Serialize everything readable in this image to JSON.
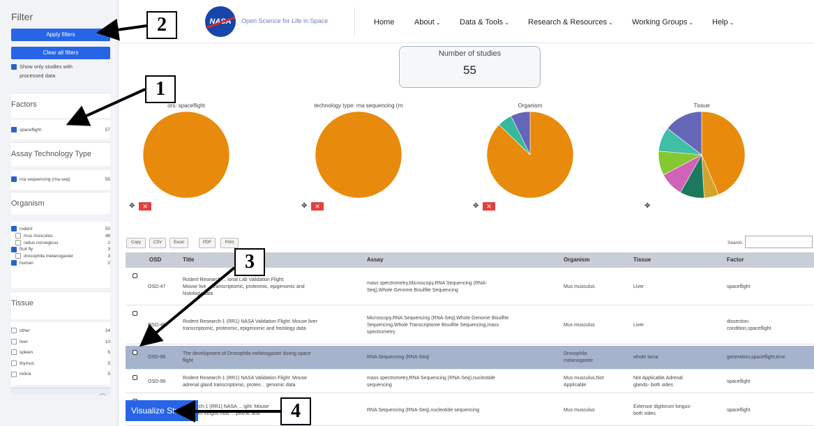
{
  "sidebar": {
    "title": "Filter",
    "apply_label": "Apply filters",
    "clear_label": "Clear all filters",
    "processed_label_1": "Show only studies with",
    "processed_label_2": "processed data",
    "factors": {
      "heading": "Factors",
      "items": [
        {
          "label": "spaceflight",
          "count": "57",
          "checked": true
        }
      ]
    },
    "assay": {
      "heading": "Assay Technology Type",
      "items": [
        {
          "label": "rna sequencing (rna-seq)",
          "count": "55",
          "checked": true
        }
      ]
    },
    "organism": {
      "heading": "Organism",
      "items": [
        {
          "label": "rodent",
          "count": "50",
          "checked": true,
          "sub": false
        },
        {
          "label": "mus musculus",
          "count": "48",
          "checked": false,
          "sub": true
        },
        {
          "label": "rattus norvegicus",
          "count": "2",
          "checked": false,
          "sub": true
        },
        {
          "label": "fruit fly",
          "count": "3",
          "checked": true,
          "sub": false
        },
        {
          "label": "drosophila melanogaster",
          "count": "3",
          "checked": false,
          "sub": true
        },
        {
          "label": "human",
          "count": "2",
          "checked": true,
          "sub": false
        }
      ]
    },
    "tissue": {
      "heading": "Tissue",
      "items": [
        {
          "label": "other",
          "count": "24"
        },
        {
          "label": "liver",
          "count": "10"
        },
        {
          "label": "spleen",
          "count": "5"
        },
        {
          "label": "thymus",
          "count": "5"
        },
        {
          "label": "retina",
          "count": "5"
        }
      ]
    }
  },
  "header": {
    "logo_text": "NASA",
    "site_title": "Open Science for Life in Space",
    "nav": [
      {
        "label": "Home",
        "dropdown": false
      },
      {
        "label": "About",
        "dropdown": true
      },
      {
        "label": "Data & Tools",
        "dropdown": true
      },
      {
        "label": "Research & Resources",
        "dropdown": true
      },
      {
        "label": "Working Groups",
        "dropdown": true
      },
      {
        "label": "Help",
        "dropdown": true
      }
    ]
  },
  "studies": {
    "label": "Number of studies",
    "value": "55"
  },
  "charts": [
    {
      "title": "ors: spaceflight",
      "slices": [
        {
          "value": 1,
          "color": "#e88a0c"
        }
      ],
      "has_remove": true
    },
    {
      "title": "technology type: rna sequencing (rn",
      "slices": [
        {
          "value": 1,
          "color": "#e88a0c"
        }
      ],
      "has_remove": true
    },
    {
      "title": "Organism",
      "slices": [
        {
          "value": 48,
          "color": "#e88a0c"
        },
        {
          "value": 3,
          "color": "#35b89c"
        },
        {
          "value": 4,
          "color": "#6666b8"
        }
      ],
      "has_remove": true
    },
    {
      "title": "Tissue",
      "slices": [
        {
          "value": 24,
          "color": "#e88a0c"
        },
        {
          "value": 3,
          "color": "#d4a52c"
        },
        {
          "value": 5,
          "color": "#1c7a5c"
        },
        {
          "value": 5,
          "color": "#d062b8"
        },
        {
          "value": 5,
          "color": "#86c832"
        },
        {
          "value": 5,
          "color": "#3fbfa8"
        },
        {
          "value": 8,
          "color": "#6666b8"
        }
      ],
      "has_remove": false
    }
  ],
  "table_tools": {
    "copy": "Copy",
    "csv": "CSV",
    "excel": "Excel",
    "pdf": "PDF",
    "print": "Print",
    "search_label": "Search:"
  },
  "table": {
    "headers": {
      "osd": "OSD",
      "title": "Title",
      "assay": "Assay",
      "organism": "Organism",
      "tissue": "Tissue",
      "factor": "Factor"
    },
    "rows": [
      {
        "osd": "OSD-47",
        "title": [
          "Rodent Research ... ional Lab Validation Flight:",
          "Mouse live ... transcriptomic, proteomic, epigenomic and",
          "histology data"
        ],
        "assay": [
          "mass spectrometry,Microscopy,RNA Sequencing (RNA-",
          "Seq),Whole Genome Bisulfite Sequencing"
        ],
        "organism": [
          "Mus musculus"
        ],
        "tissue": [
          "Liver"
        ],
        "factor": [
          "spaceflight"
        ],
        "selected": false
      },
      {
        "osd": "OSD-48",
        "title": [
          "Rodent Research-1 (RR1) NASA Validation Flight: Mouse liver",
          "transcriptomic, proteomic, epigenomic and histology data"
        ],
        "assay": [
          "Microscopy,RNA Sequencing (RNA-Seq),Whole Genome Bisulfite",
          "Sequencing,Whole Transcriptome Bisulfite Sequencing,mass",
          "spectrometry"
        ],
        "organism": [
          "Mus musculus"
        ],
        "tissue": [
          "Liver"
        ],
        "factor": [
          "dissection",
          "condition,spaceflight"
        ],
        "selected": false
      },
      {
        "osd": "OSD-96",
        "title": [
          "The development of Drosophila melanogaster during space",
          "flight"
        ],
        "assay": [
          "RNA Sequencing (RNA-Seq)"
        ],
        "organism": [
          "Drosophila",
          "melanogaster"
        ],
        "tissue": [
          "whole larva"
        ],
        "factor": [
          "generation,spaceflight,time"
        ],
        "selected": true
      },
      {
        "osd": "OSD-98",
        "title": [
          "Rodent Research-1 (RR1) NASA Validation Flight: Mouse",
          "adrenal gland transcriptomic, proteo... genomic data"
        ],
        "assay": [
          "mass spectrometry,RNA Sequencing (RNA-Seq),nucleotide",
          "sequencing"
        ],
        "organism": [
          "Mus musculus,Not",
          "Applicable"
        ],
        "tissue": [
          "Not Applicable,Adrenal",
          "glands- both sides"
        ],
        "factor": [
          "spaceflight"
        ],
        "selected": false
      },
      {
        "osd": "",
        "title": [
          "Research-1 (RR1) NASA ... ight: Mouse",
          "digitorum longus mus ... ptomic and"
        ],
        "assay": [
          "RNA Sequencing (RNA-Seq),nucleotide sequencing"
        ],
        "organism": [
          "Mus musculus"
        ],
        "tissue": [
          "Extensor digitorum longus-",
          "both sides"
        ],
        "factor": [
          "spaceflight"
        ],
        "selected": false
      }
    ]
  },
  "visualize_label": "Visualize Stu",
  "callouts": [
    "1",
    "2",
    "3",
    "4"
  ]
}
